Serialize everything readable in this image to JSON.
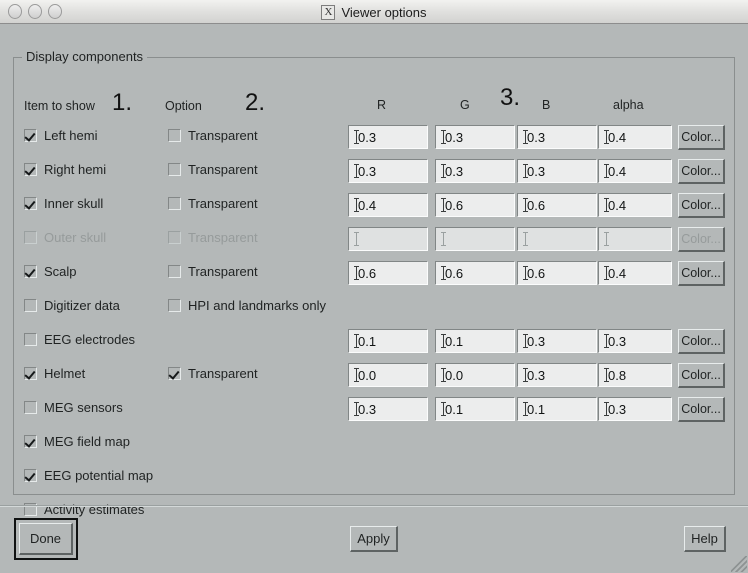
{
  "window": {
    "title": "Viewer options",
    "x11_icon_glyph": "X",
    "traffic_lights": [
      "close-button",
      "minimize-button",
      "zoom-button"
    ]
  },
  "group": {
    "legend": "Display components"
  },
  "headers": {
    "item": "Item to show",
    "option": "Option",
    "r": "R",
    "g": "G",
    "b": "B",
    "alpha": "alpha"
  },
  "annotations": {
    "one": "1.",
    "two": "2.",
    "three": "3."
  },
  "color_button_label": "Color...",
  "rows": [
    {
      "item_label": "Left hemi",
      "item_checked": true,
      "option_label": "Transparent",
      "option_checked": false,
      "has_option": true,
      "has_fields": true,
      "has_color": true,
      "enabled": true,
      "r": "0.3",
      "g": "0.3",
      "b": "0.3",
      "alpha": "0.4"
    },
    {
      "item_label": "Right hemi",
      "item_checked": true,
      "option_label": "Transparent",
      "option_checked": false,
      "has_option": true,
      "has_fields": true,
      "has_color": true,
      "enabled": true,
      "r": "0.3",
      "g": "0.3",
      "b": "0.3",
      "alpha": "0.4"
    },
    {
      "item_label": "Inner skull",
      "item_checked": true,
      "option_label": "Transparent",
      "option_checked": false,
      "has_option": true,
      "has_fields": true,
      "has_color": true,
      "enabled": true,
      "r": "0.4",
      "g": "0.6",
      "b": "0.6",
      "alpha": "0.4"
    },
    {
      "item_label": "Outer skull",
      "item_checked": false,
      "option_label": "Transparent",
      "option_checked": false,
      "has_option": true,
      "has_fields": true,
      "has_color": true,
      "enabled": false,
      "r": "",
      "g": "",
      "b": "",
      "alpha": ""
    },
    {
      "item_label": "Scalp",
      "item_checked": true,
      "option_label": "Transparent",
      "option_checked": false,
      "has_option": true,
      "has_fields": true,
      "has_color": true,
      "enabled": true,
      "r": "0.6",
      "g": "0.6",
      "b": "0.6",
      "alpha": "0.4"
    },
    {
      "item_label": "Digitizer data",
      "item_checked": false,
      "option_label": "HPI and landmarks only",
      "option_checked": false,
      "has_option": true,
      "has_fields": false,
      "has_color": false,
      "enabled": true,
      "r": "",
      "g": "",
      "b": "",
      "alpha": ""
    },
    {
      "item_label": "EEG electrodes",
      "item_checked": false,
      "option_label": "",
      "option_checked": false,
      "has_option": false,
      "has_fields": true,
      "has_color": true,
      "enabled": true,
      "r": "0.1",
      "g": "0.1",
      "b": "0.3",
      "alpha": "0.3"
    },
    {
      "item_label": "Helmet",
      "item_checked": true,
      "option_label": "Transparent",
      "option_checked": true,
      "has_option": true,
      "has_fields": true,
      "has_color": true,
      "enabled": true,
      "r": "0.0",
      "g": "0.0",
      "b": "0.3",
      "alpha": "0.8"
    },
    {
      "item_label": "MEG sensors",
      "item_checked": false,
      "option_label": "",
      "option_checked": false,
      "has_option": false,
      "has_fields": true,
      "has_color": true,
      "enabled": true,
      "r": "0.3",
      "g": "0.1",
      "b": "0.1",
      "alpha": "0.3"
    },
    {
      "item_label": "MEG field map",
      "item_checked": true,
      "option_label": "",
      "option_checked": false,
      "has_option": false,
      "has_fields": false,
      "has_color": false,
      "enabled": true,
      "r": "",
      "g": "",
      "b": "",
      "alpha": ""
    },
    {
      "item_label": "EEG potential map",
      "item_checked": true,
      "option_label": "",
      "option_checked": false,
      "has_option": false,
      "has_fields": false,
      "has_color": false,
      "enabled": true,
      "r": "",
      "g": "",
      "b": "",
      "alpha": ""
    },
    {
      "item_label": "Activity estimates",
      "item_checked": false,
      "option_label": "",
      "option_checked": false,
      "has_option": false,
      "has_fields": false,
      "has_color": false,
      "enabled": true,
      "r": "",
      "g": "",
      "b": "",
      "alpha": ""
    }
  ],
  "footer": {
    "done": "Done",
    "apply": "Apply",
    "help": "Help"
  },
  "colors": {
    "dialog_bg": "#b4b8b8",
    "field_bg": "#eceded",
    "text": "#1f2222",
    "disabled_text": "#969b9b",
    "titlebar_bg": "#e6e6e4"
  }
}
